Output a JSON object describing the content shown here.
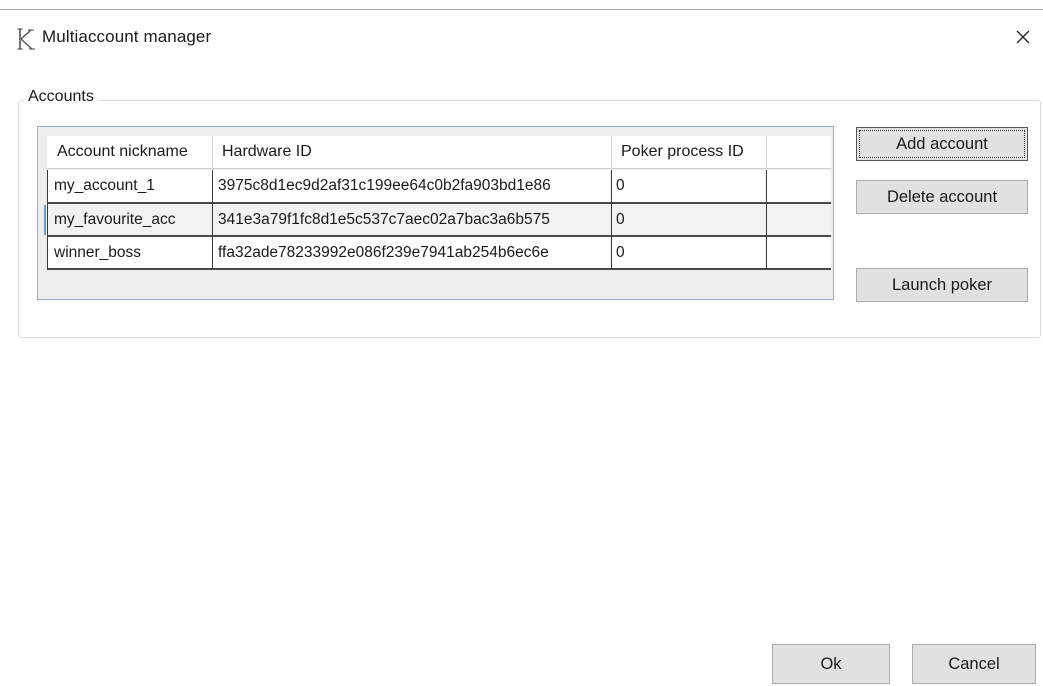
{
  "window": {
    "title": "Multiaccount manager",
    "logo_icon": "k-logo-icon",
    "close_icon": "close-icon"
  },
  "accounts_group": {
    "title": "Accounts",
    "columns": [
      "Account nickname",
      "Hardware ID",
      "Poker process ID"
    ],
    "rows": [
      {
        "nickname": "my_account_1",
        "hardware_id": "3975c8d1ec9d2af31c199ee64c0b2fa903bd1e86",
        "process_id": "0"
      },
      {
        "nickname": "my_favourite_acc",
        "hardware_id": "341e3a79f1fc8d1e5c537c7aec02a7bac3a6b575",
        "process_id": "0"
      },
      {
        "nickname": "winner_boss",
        "hardware_id": "ffa32ade78233992e086f239e7941ab254b6ec6e",
        "process_id": "0"
      }
    ]
  },
  "side_buttons": {
    "add": "Add account",
    "delete": "Delete account",
    "launch": "Launch poker"
  },
  "footer": {
    "ok": "Ok",
    "cancel": "Cancel"
  }
}
